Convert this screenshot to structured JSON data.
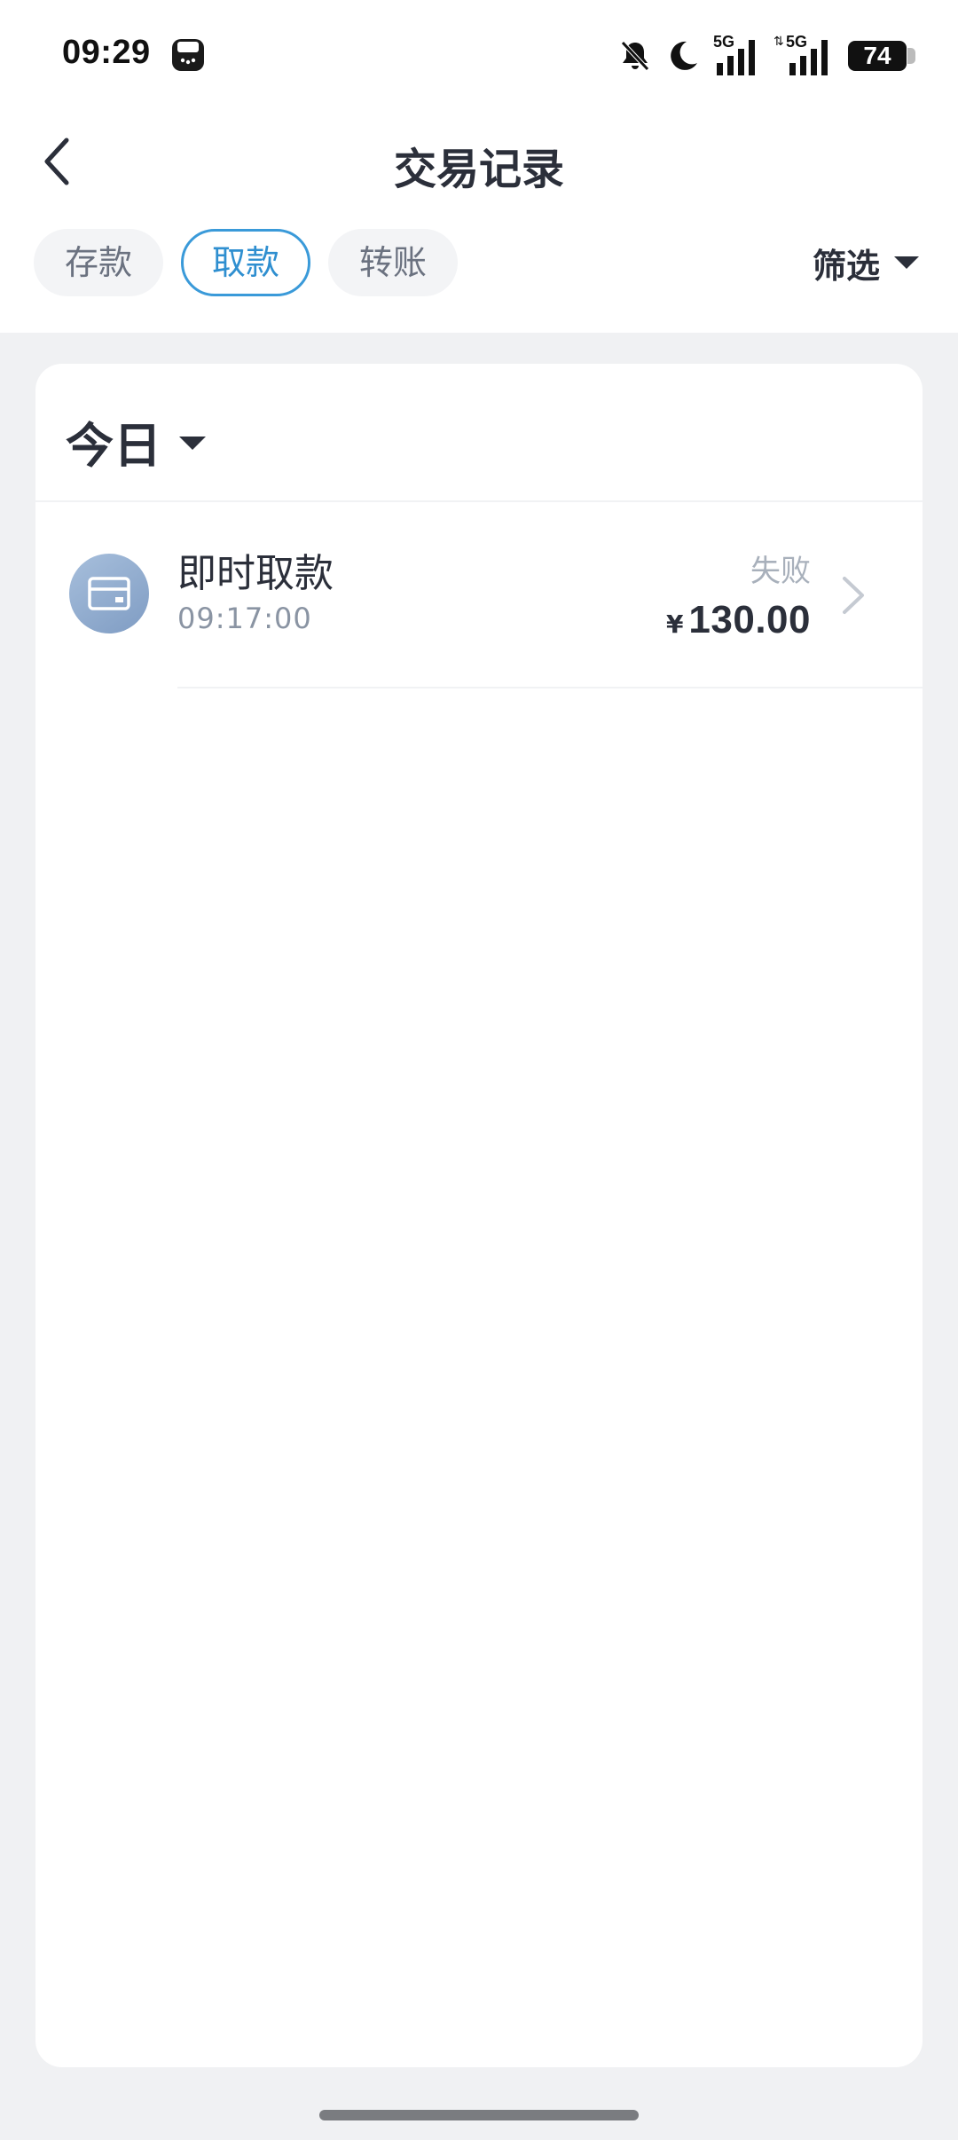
{
  "status_bar": {
    "time": "09:29",
    "battery": "74",
    "signal_1": "5G",
    "signal_2": "5G"
  },
  "header": {
    "title": "交易记录"
  },
  "tabs": [
    {
      "label": "存款",
      "active": false
    },
    {
      "label": "取款",
      "active": true
    },
    {
      "label": "转账",
      "active": false
    }
  ],
  "filter": {
    "label": "筛选"
  },
  "date_section": {
    "label": "今日"
  },
  "transactions": [
    {
      "name": "即时取款",
      "time": "09:17:00",
      "status": "失败",
      "currency": "¥",
      "amount": "130.00"
    }
  ],
  "colors": {
    "accent": "#3a9ad9",
    "page_bg": "#f0f1f3",
    "text_primary": "#2b2f3a",
    "text_secondary": "#8a94a3",
    "status_failed": "#a8b0bb"
  }
}
